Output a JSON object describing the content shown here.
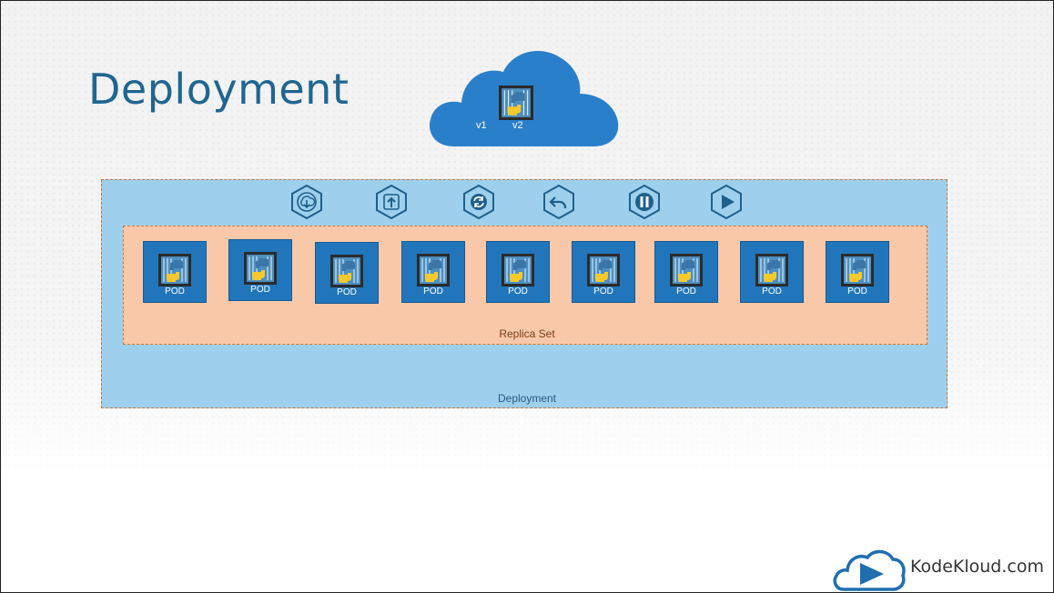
{
  "slide": {
    "title": "Deployment",
    "cloud": {
      "versions": [
        "v1",
        "v2"
      ]
    },
    "controls": [
      "download-icon",
      "upgrade-icon",
      "refresh-icon",
      "undo-icon",
      "pause-icon",
      "play-icon"
    ],
    "deployment_label": "Deployment",
    "replica_set_label": "Replica Set",
    "pods": [
      "POD",
      "POD",
      "POD",
      "POD",
      "POD",
      "POD",
      "POD",
      "POD",
      "POD"
    ],
    "brand": "KodeKloud.com"
  },
  "colors": {
    "title": "#1f6690",
    "cloud": "#2a7fca",
    "deployment_fill": "#9ed0ee",
    "replica_fill": "#f8c8a9",
    "dash": "#c8763e",
    "pod_fill": "#2176bb",
    "python_blue": "#3a76a8",
    "python_yellow": "#f5c92b"
  }
}
